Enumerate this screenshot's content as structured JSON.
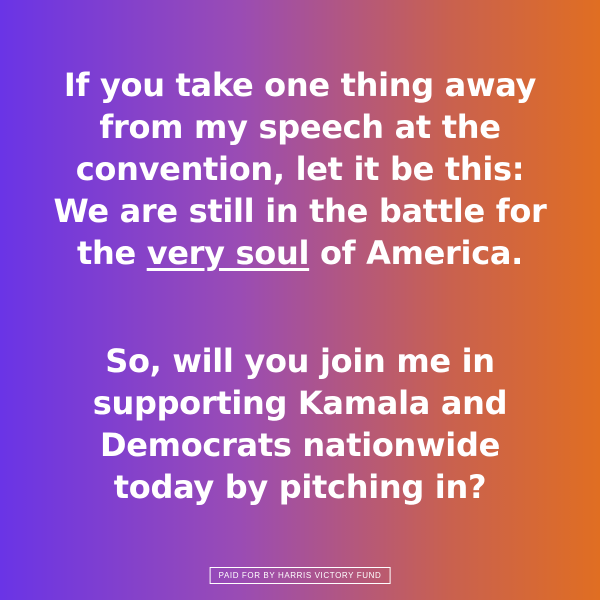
{
  "message_1": {
    "line_1": "If you take one thing away",
    "line_2": "from my speech at the",
    "line_3": "convention, let it be this:",
    "line_4": "We are still in the battle for",
    "line_5_start": "the ",
    "line_5_underlined": "very soul",
    "line_5_end": " of America."
  },
  "message_2": {
    "line_1": "So, will you join me in",
    "line_2": "supporting Kamala and",
    "line_3": "Democrats nationwide",
    "line_4": "today by pitching in?"
  },
  "disclaimer": "PAID FOR BY HARRIS VICTORY FUND",
  "colors": {
    "gradient_start": "#6a34e6",
    "gradient_end": "#e06e22",
    "text": "#ffffff"
  }
}
